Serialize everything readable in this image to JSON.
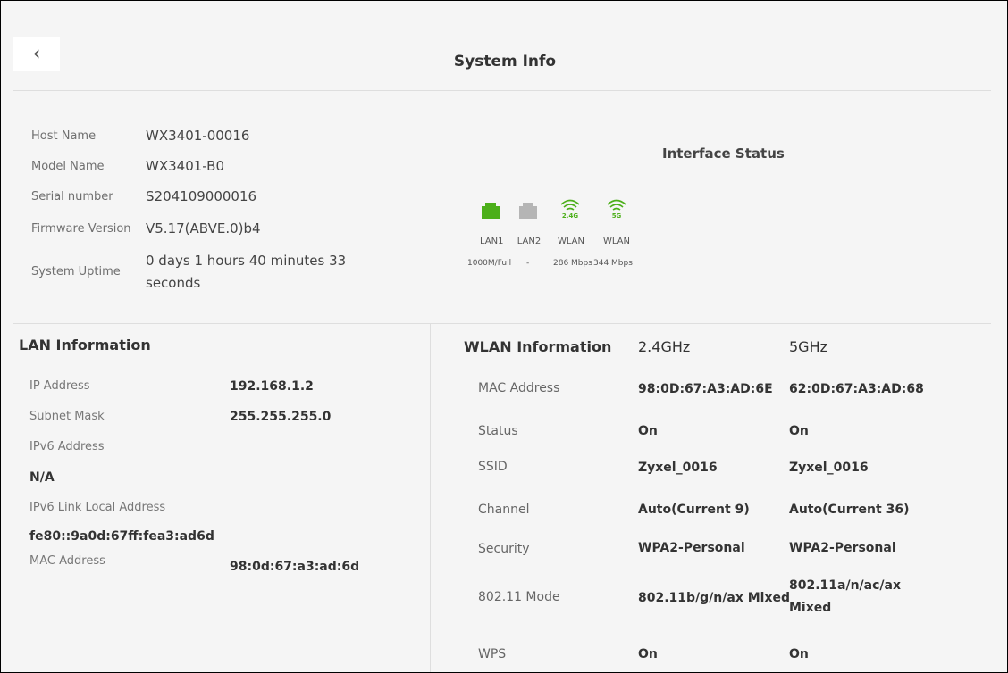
{
  "header": {
    "back_icon": "chevron-left-icon",
    "title": "System Info"
  },
  "system": {
    "rows": [
      {
        "label": "Host Name",
        "value": "WX3401-00016"
      },
      {
        "label": "Model Name",
        "value": "WX3401-B0"
      },
      {
        "label": "Serial number",
        "value": "S204109000016"
      },
      {
        "label": "Firmware Version",
        "value": "V5.17(ABVE.0)b4"
      },
      {
        "label": "System Uptime",
        "value_line1": "0 days 1 hours 40 minutes 33",
        "value_line2": "seconds"
      }
    ]
  },
  "interface_status": {
    "title": "Interface Status",
    "ports": [
      {
        "name": "LAN1",
        "icon": "ethernet-port-icon",
        "badge": "",
        "color": "#4caf1a",
        "speed": "1000M/Full"
      },
      {
        "name": "LAN2",
        "icon": "ethernet-port-icon",
        "badge": "",
        "color": "#b5b5b5",
        "speed": "-"
      },
      {
        "name": "WLAN",
        "icon": "wifi-icon",
        "badge": "2.4G",
        "color": "#4caf1a",
        "speed": "286 Mbps"
      },
      {
        "name": "WLAN",
        "icon": "wifi-icon",
        "badge": "5G",
        "color": "#4caf1a",
        "speed": "344 Mbps"
      }
    ]
  },
  "lan": {
    "title": "LAN Information",
    "ip_label": "IP Address",
    "ip_value": "192.168.1.2",
    "mask_label": "Subnet Mask",
    "mask_value": "255.255.255.0",
    "ipv6_label": "IPv6 Address",
    "ipv6_value": "N/A",
    "ipv6_link_label": "IPv6 Link Local Address",
    "ipv6_link_value": "fe80::9a0d:67ff:fea3:ad6d",
    "mac_label": "MAC Address",
    "mac_value": "98:0d:67:a3:ad:6d"
  },
  "wlan": {
    "title": "WLAN Information",
    "col_24": "2.4GHz",
    "col_5": "5GHz",
    "rows": [
      {
        "label": "MAC Address",
        "v24": "98:0D:67:A3:AD:6E",
        "v5": "62:0D:67:A3:AD:68"
      },
      {
        "label": "Status",
        "v24": "On",
        "v5": "On"
      },
      {
        "label": "SSID",
        "v24": "Zyxel_0016",
        "v5": "Zyxel_0016"
      },
      {
        "label": "Channel",
        "v24": "Auto(Current 9)",
        "v5": "Auto(Current 36)"
      },
      {
        "label": "Security",
        "v24": "WPA2-Personal",
        "v5": "WPA2-Personal"
      },
      {
        "label": "802.11 Mode",
        "v24": "802.11b/g/n/ax Mixed",
        "v5_line1": "802.11a/n/ac/ax",
        "v5_line2": "Mixed"
      },
      {
        "label": "WPS",
        "v24": "On",
        "v5": "On"
      }
    ]
  }
}
